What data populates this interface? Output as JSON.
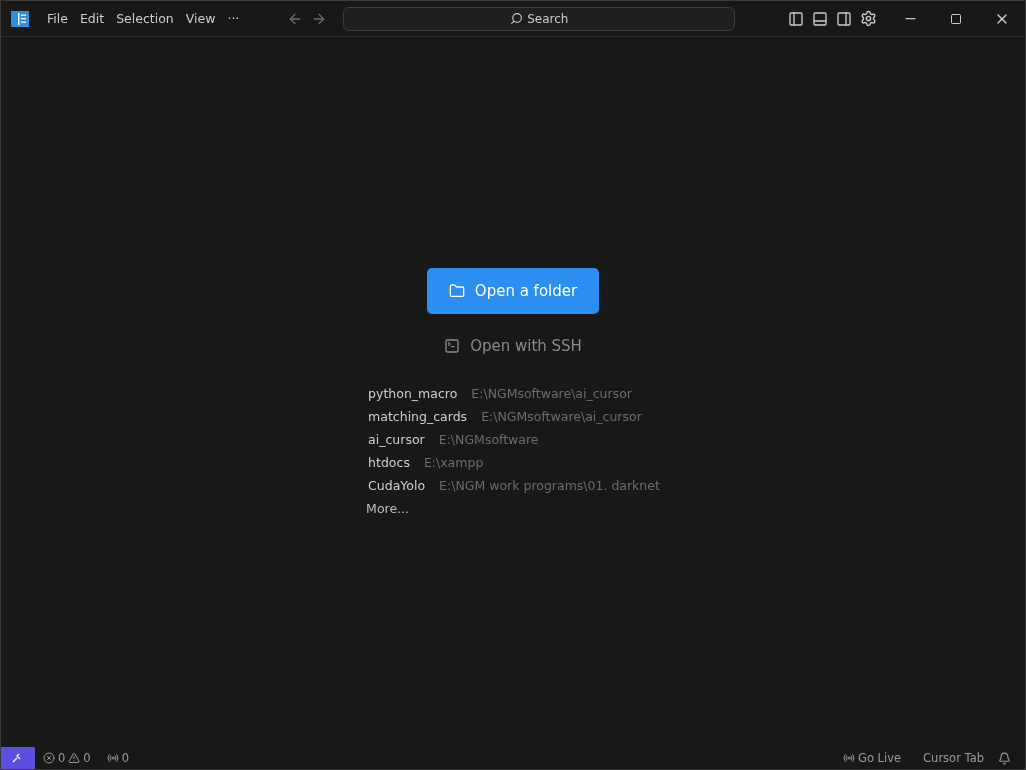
{
  "menu": [
    "File",
    "Edit",
    "Selection",
    "View",
    "···"
  ],
  "search": {
    "placeholder": "Search"
  },
  "welcome": {
    "primary_button": "Open a folder",
    "secondary_button": "Open with SSH",
    "recent": [
      {
        "name": "python_macro",
        "path": "E:\\NGMsoftware\\ai_cursor"
      },
      {
        "name": "matching_cards",
        "path": "E:\\NGMsoftware\\ai_cursor"
      },
      {
        "name": "ai_cursor",
        "path": "E:\\NGMsoftware"
      },
      {
        "name": "htdocs",
        "path": "E:\\xampp"
      },
      {
        "name": "CudaYolo",
        "path": "E:\\NGM work programs\\01. darknet"
      }
    ],
    "more": "More..."
  },
  "status_bar": {
    "errors": "0",
    "warnings": "0",
    "ports": "0",
    "right": [
      "Go Live",
      "Cursor Tab"
    ]
  }
}
